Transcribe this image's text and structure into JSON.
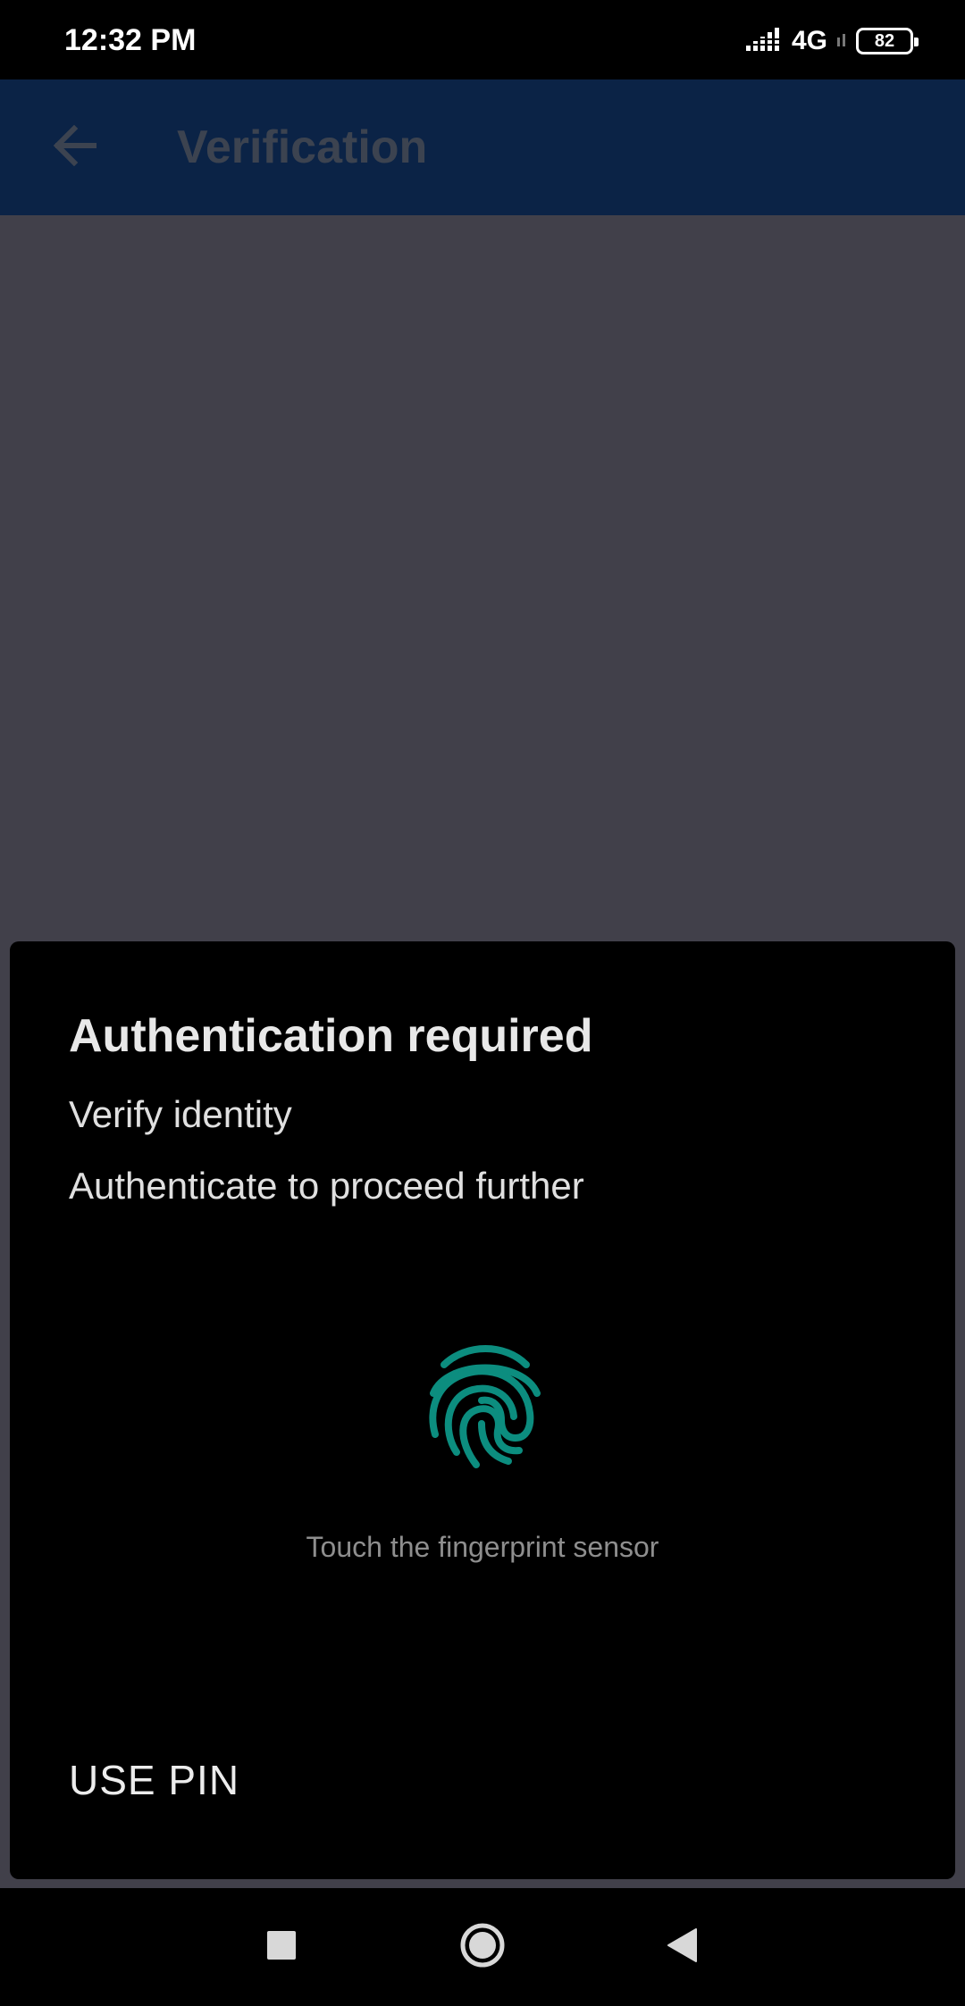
{
  "status_bar": {
    "time": "12:32 PM",
    "network": "4G",
    "battery": "82"
  },
  "app_bar": {
    "title": "Verification",
    "back_icon": "arrow-left-icon"
  },
  "dialog": {
    "title": "Authentication required",
    "subtitle": "Verify identity",
    "description": "Authenticate to proceed further",
    "icon": "fingerprint-icon",
    "hint": "Touch the fingerprint sensor",
    "negative_button": "USE PIN"
  },
  "nav_bar": {
    "recents_icon": "square-icon",
    "home_icon": "circle-icon",
    "back_icon": "triangle-back-icon"
  },
  "colors": {
    "app_bar": "#0b2346",
    "scrim": "#41404a",
    "fingerprint": "#0c8d7f",
    "sheet": "#000000"
  }
}
